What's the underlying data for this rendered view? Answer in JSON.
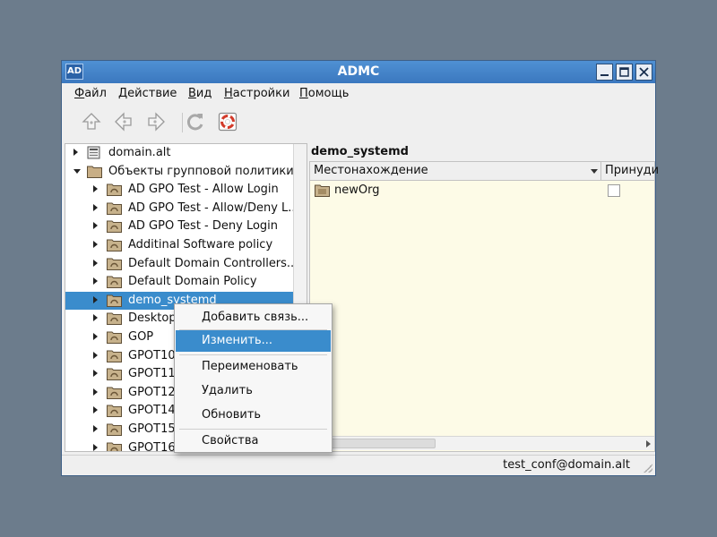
{
  "window": {
    "title": "ADMC",
    "icon_text": "AD"
  },
  "menubar": [
    {
      "pre": "",
      "ul": "Ф",
      "post": "айл"
    },
    {
      "pre": "",
      "ul": "Д",
      "post": "ействие"
    },
    {
      "pre": "",
      "ul": "В",
      "post": "ид"
    },
    {
      "pre": "",
      "ul": "Н",
      "post": "астройки"
    },
    {
      "pre": "",
      "ul": "П",
      "post": "омощь"
    }
  ],
  "toolbar": {
    "icons": [
      "up-arrow-icon",
      "back-arrow-icon",
      "forward-arrow-icon",
      "refresh-icon",
      "help-lifebuoy-icon"
    ]
  },
  "tree": {
    "items": [
      {
        "label": "domain.alt",
        "level": 0,
        "expanded": false,
        "icon": "domain-icon"
      },
      {
        "label": "Объекты групповой политики",
        "level": 0,
        "expanded": true,
        "icon": "folder-icon"
      },
      {
        "label": "AD GPO Test - Allow Login",
        "level": 1,
        "expanded": false,
        "icon": "gpo-icon"
      },
      {
        "label": "AD GPO Test - Allow/Deny L...",
        "level": 1,
        "expanded": false,
        "icon": "gpo-icon"
      },
      {
        "label": "AD GPO Test - Deny Login",
        "level": 1,
        "expanded": false,
        "icon": "gpo-icon"
      },
      {
        "label": "Additinal Software policy",
        "level": 1,
        "expanded": false,
        "icon": "gpo-icon"
      },
      {
        "label": "Default Domain Controllers...",
        "level": 1,
        "expanded": false,
        "icon": "gpo-icon"
      },
      {
        "label": "Default Domain Policy",
        "level": 1,
        "expanded": false,
        "icon": "gpo-icon"
      },
      {
        "label": "demo_systemd",
        "level": 1,
        "expanded": false,
        "icon": "gpo-icon",
        "selected": true
      },
      {
        "label": "Desktop",
        "level": 1,
        "expanded": false,
        "icon": "gpo-icon"
      },
      {
        "label": "GOP",
        "level": 1,
        "expanded": false,
        "icon": "gpo-icon"
      },
      {
        "label": "GPOT10",
        "level": 1,
        "expanded": false,
        "icon": "gpo-icon"
      },
      {
        "label": "GPOT11",
        "level": 1,
        "expanded": false,
        "icon": "gpo-icon"
      },
      {
        "label": "GPOT12",
        "level": 1,
        "expanded": false,
        "icon": "gpo-icon"
      },
      {
        "label": "GPOT14",
        "level": 1,
        "expanded": false,
        "icon": "gpo-icon"
      },
      {
        "label": "GPOT15",
        "level": 1,
        "expanded": false,
        "icon": "gpo-icon"
      },
      {
        "label": "GPOT16",
        "level": 1,
        "expanded": false,
        "icon": "gpo-icon"
      }
    ]
  },
  "right_panel": {
    "header": "demo_systemd",
    "columns": [
      "Местонахождение",
      "Принуди"
    ],
    "rows": [
      {
        "location": "newOrg",
        "enforced": false
      }
    ]
  },
  "context_menu": {
    "items": [
      {
        "label": "Добавить связь...",
        "active": false
      },
      {
        "label": "Изменить...",
        "active": true
      },
      {
        "label": "Переименовать",
        "active": false
      },
      {
        "label": "Удалить",
        "active": false
      },
      {
        "label": "Обновить",
        "active": false
      },
      {
        "label": "Свойства",
        "active": false
      }
    ]
  },
  "status_bar": {
    "text": "test_conf@domain.alt"
  },
  "colors": {
    "selection": "#3a8ccc",
    "titlebar": "#3b78bf",
    "table_bg": "#fdfbe7",
    "desktop": "#6c7c8c"
  }
}
